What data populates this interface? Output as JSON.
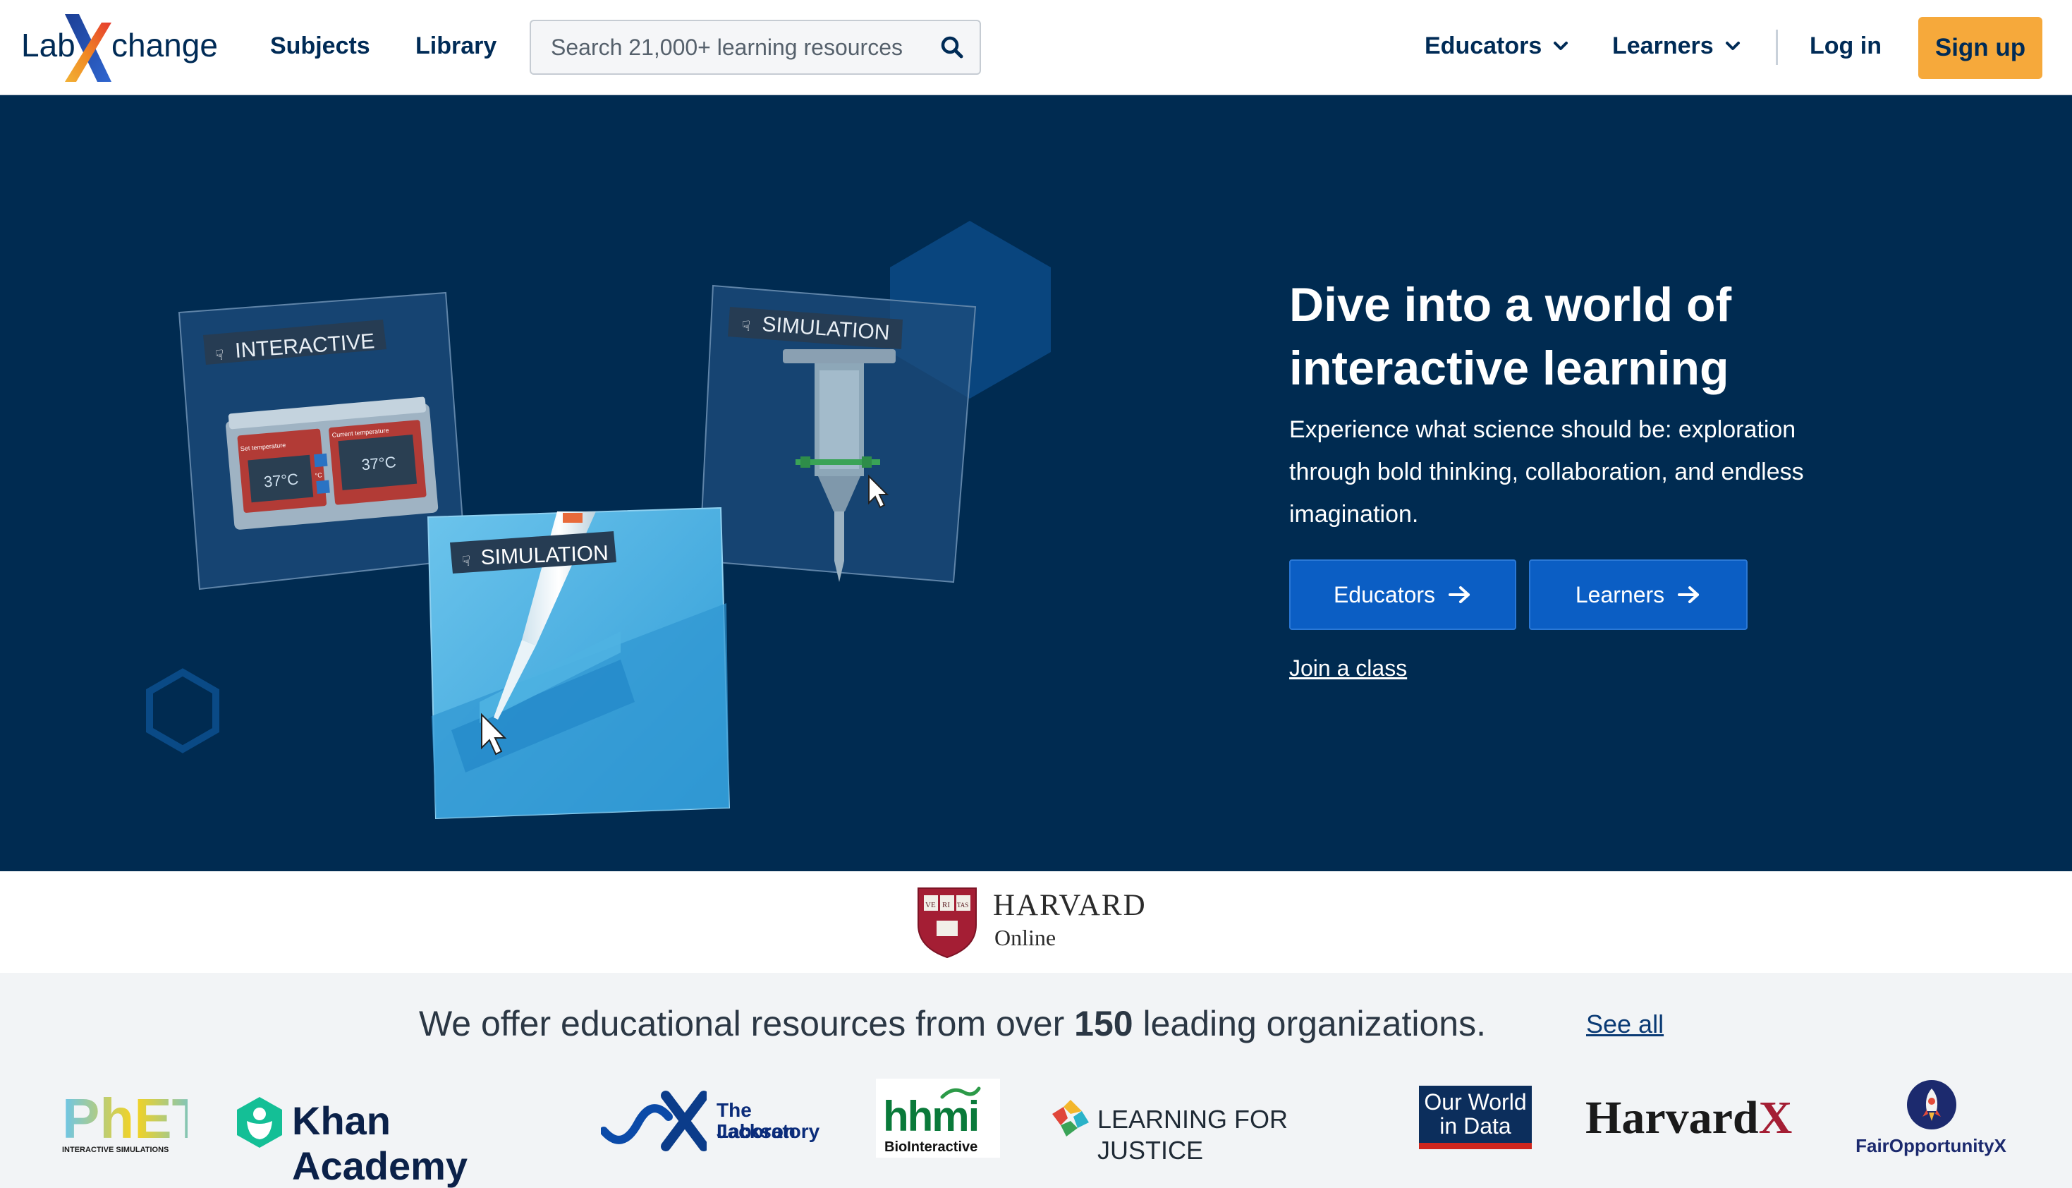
{
  "header": {
    "logo_text_left": "Lab",
    "logo_text_x": "X",
    "logo_text_right": "change",
    "nav": {
      "subjects": "Subjects",
      "library": "Library"
    },
    "search": {
      "placeholder": "Search 21,000+ learning resources",
      "icon": "search-icon"
    },
    "menus": {
      "educators": "Educators",
      "learners": "Learners",
      "chevron_icon": "chevron-down-icon"
    },
    "login": "Log in",
    "signup": "Sign up"
  },
  "hero": {
    "title": "Dive into a world of interactive learning",
    "description": "Experience what science should be: exploration through bold thinking, collaboration, and endless imagination.",
    "buttons": {
      "educators": "Educators",
      "learners": "Learners",
      "arrow_icon": "arrow-right-icon"
    },
    "join_class": "Join a class",
    "cards": [
      {
        "tag": "INTERACTIVE",
        "set_label": "Set temperature",
        "current_label": "Current temperature",
        "set_value": "37°C",
        "current_value": "37°C",
        "unit": "°C"
      },
      {
        "tag": "SIMULATION"
      },
      {
        "tag": "SIMULATION"
      }
    ]
  },
  "featured_partner": {
    "name": "HARVARD",
    "subtitle": "Online",
    "shield_letters": [
      "VE",
      "RI",
      "TAS"
    ]
  },
  "partners": {
    "heading_before": "We offer educational resources from over",
    "heading_count": "150",
    "heading_after": "leading organizations.",
    "see_all": "See all",
    "logos": {
      "phet": {
        "name": "PhET",
        "sub": "INTERACTIVE SIMULATIONS"
      },
      "khan": {
        "name": "Khan Academy"
      },
      "jackson": {
        "line1": "The Jackson",
        "line2": "Laboratory"
      },
      "hhmi": {
        "name": "hhmi",
        "sub": "BioInteractive"
      },
      "lfj": {
        "name": "LEARNING FOR JUSTICE"
      },
      "owid": {
        "line1": "Our World",
        "line2": "in Data"
      },
      "harvardx": {
        "name": "Harvard",
        "x": "X"
      },
      "fox": {
        "name": "FairOpportunityX"
      }
    }
  },
  "colors": {
    "navy": "#002b51",
    "hero_button": "#0b5ec4",
    "signup_button": "#f6a93b",
    "harvard_crimson": "#a41e34"
  }
}
